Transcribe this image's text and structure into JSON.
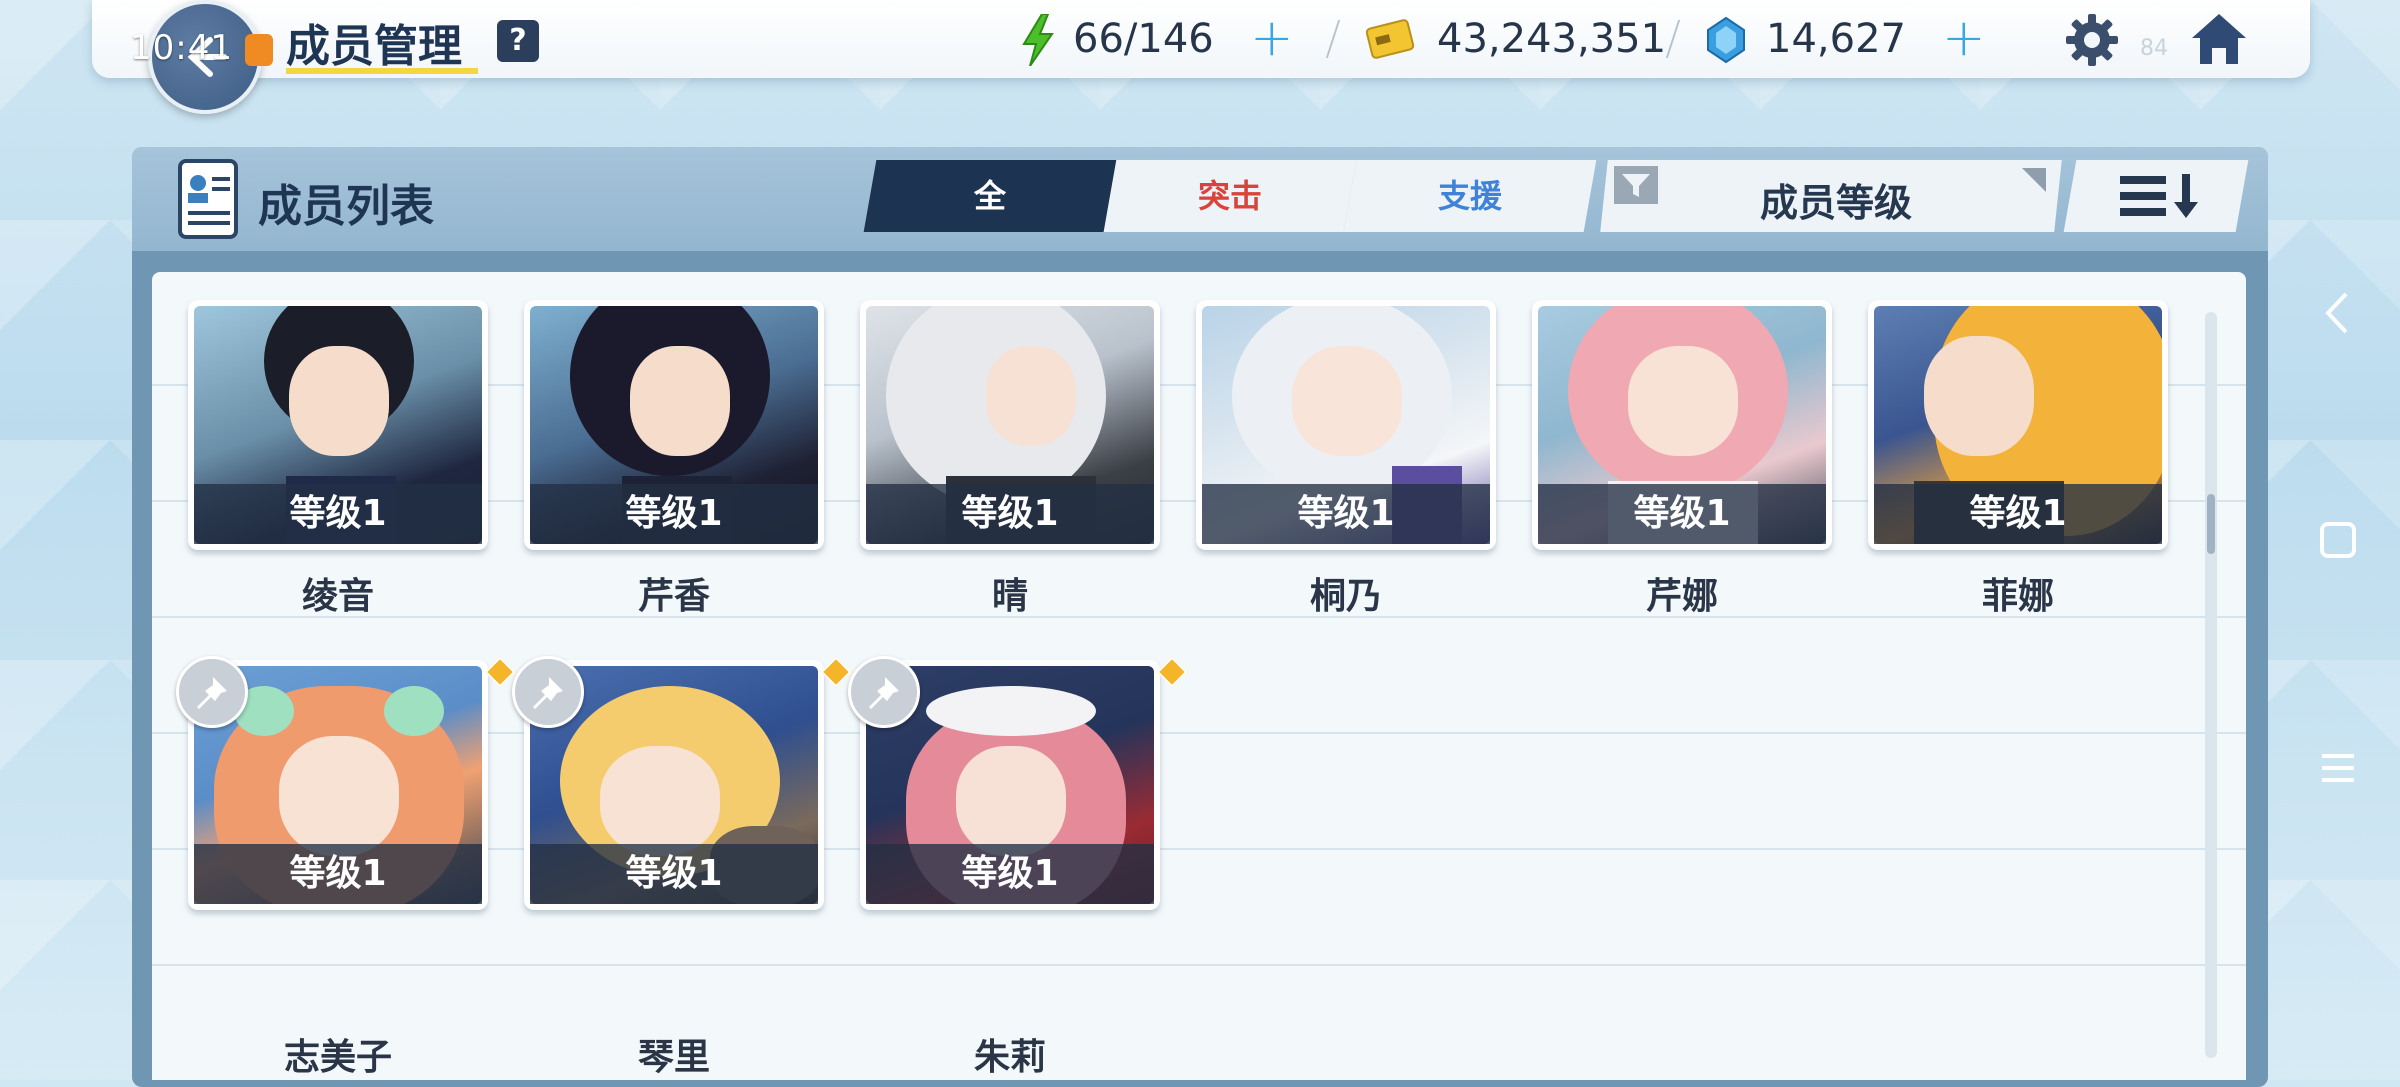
{
  "status_bar": {
    "time": "10:41",
    "battery": "84"
  },
  "header": {
    "title": "成员管理",
    "help_label": "?",
    "ap": "66/146",
    "credits": "43,243,351",
    "gems": "14,627"
  },
  "panel": {
    "title": "成员列表",
    "tabs": [
      {
        "label": "全",
        "active": true,
        "color": "#ffffff"
      },
      {
        "label": "突击",
        "active": false,
        "color": "#d9433b"
      },
      {
        "label": "支援",
        "active": false,
        "color": "#3f83d8"
      }
    ],
    "sort_label": "成员等级"
  },
  "members": [
    {
      "name": "绫音",
      "level": "等级1"
    },
    {
      "name": "芹香",
      "level": "等级1"
    },
    {
      "name": "晴",
      "level": "等级1"
    },
    {
      "name": "桐乃",
      "level": "等级1"
    },
    {
      "name": "芹娜",
      "level": "等级1"
    },
    {
      "name": "菲娜",
      "level": "等级1"
    },
    {
      "name": "志美子",
      "level": "等级1"
    },
    {
      "name": "琴里",
      "level": "等级1"
    },
    {
      "name": "朱莉",
      "level": "等级1"
    }
  ],
  "colors": {
    "accent_dark": "#1c3451",
    "ap_green": "#4bbf2a",
    "credit_yellow": "#f2c531",
    "gem_blue": "#3a9fe0"
  }
}
